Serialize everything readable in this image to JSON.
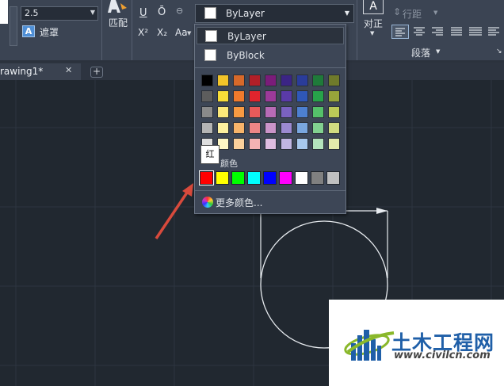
{
  "ribbon": {
    "textheight_value": "2.5",
    "mask_label": "遮罩",
    "match_label": "匹配",
    "superscript_label": "X²",
    "subscript_label": "X₂",
    "case_label": "Aa",
    "underline_label": "U",
    "overline_label": "Ō",
    "color_select_value": "ByLayer",
    "justify_label": "对正",
    "line_spacing_label": "行距",
    "paragraph_label": "段落"
  },
  "tabs": {
    "drawing_label": "rawing1*",
    "close_glyph": "✕",
    "add_glyph": "+"
  },
  "dropdown": {
    "bylayer_label": "ByLayer",
    "byblock_label": "ByBlock",
    "index_colors_label": "颜色",
    "more_colors_label": "更多颜色...",
    "palette_rows": [
      [
        "#000000",
        "#f2c429",
        "#d7692a",
        "#b21f28",
        "#7b1c7a",
        "#3b2485",
        "#2a3c9a",
        "#1f7a3a",
        "#6f7a2b"
      ],
      [
        "#5d5d5d",
        "#f8dd38",
        "#f07a2c",
        "#e0242d",
        "#9c3a99",
        "#5a3aa8",
        "#2f57b8",
        "#27a34a",
        "#98a43a"
      ],
      [
        "#8a8a8a",
        "#fbe87a",
        "#f79a42",
        "#e95a5a",
        "#b86bb6",
        "#7a62c0",
        "#4d80d0",
        "#55c06a",
        "#bcc958"
      ],
      [
        "#b4b4b4",
        "#fdf09e",
        "#f8b46a",
        "#ee8686",
        "#cb94c9",
        "#9c8ad1",
        "#7aa7df",
        "#82d190",
        "#d1db80"
      ],
      [
        "#dedede",
        "#fef7c4",
        "#fbd09b",
        "#f4b3b3",
        "#dfbde0",
        "#c1b6e2",
        "#a8c8ec",
        "#b3e3bc",
        "#e4eaaa"
      ]
    ],
    "index_colors": [
      "#ff0000",
      "#ffff00",
      "#00ff00",
      "#00ffff",
      "#0000ff",
      "#ff00ff",
      "#ffffff",
      "#808080",
      "#c0c0c0"
    ]
  },
  "tooltip": {
    "text": "红"
  },
  "watermark": {
    "brand_name": "土木工程网",
    "url": "www.civilcn.com"
  }
}
